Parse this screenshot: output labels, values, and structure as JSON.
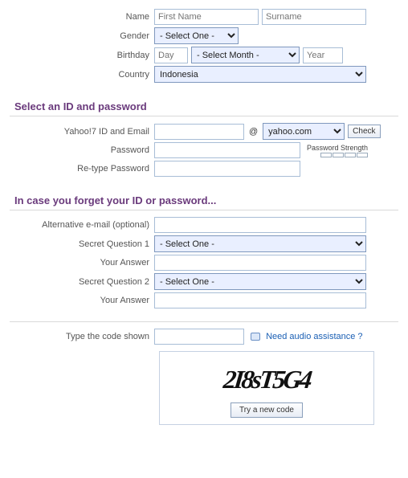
{
  "personal": {
    "name_label": "Name",
    "first_name_ph": "First Name",
    "surname_ph": "Surname",
    "gender_label": "Gender",
    "gender_value": "- Select One -",
    "birthday_label": "Birthday",
    "day_ph": "Day",
    "month_value": "- Select Month -",
    "year_ph": "Year",
    "country_label": "Country",
    "country_value": "Indonesia"
  },
  "id_section": {
    "title": "Select an ID and password",
    "yahoo_id_label": "Yahoo!7 ID and Email",
    "at": "@",
    "domain_value": "yahoo.com",
    "check_label": "Check",
    "password_label": "Password",
    "strength_label": "Password Strength",
    "retype_label": "Re-type Password"
  },
  "forgot_section": {
    "title": "In case you forget your ID or password...",
    "alt_email_label": "Alternative e-mail (optional)",
    "sq1_label": "Secret Question 1",
    "sq_value": "- Select One -",
    "answer_label": "Your Answer",
    "sq2_label": "Secret Question 2"
  },
  "captcha": {
    "type_code_label": "Type the code shown",
    "audio_link": "Need audio assistance ?",
    "code_text": "2I8sT5G4",
    "try_new_label": "Try a new code"
  }
}
